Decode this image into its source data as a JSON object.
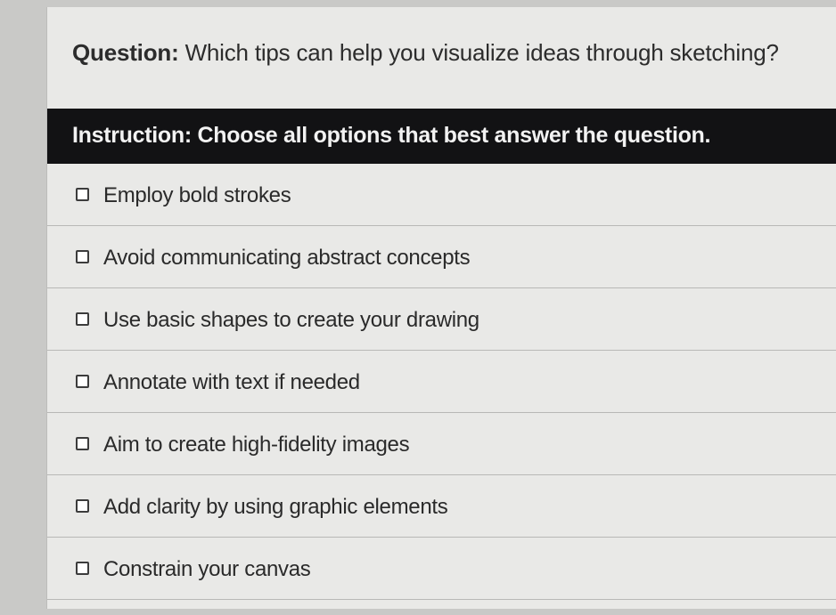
{
  "question": {
    "prefix": "Question:",
    "text": "Which tips can help you visualize ideas through sketching?"
  },
  "instruction": {
    "text": "Instruction: Choose all options that best answer the question."
  },
  "options": [
    {
      "label": "Employ bold strokes",
      "checked": false
    },
    {
      "label": "Avoid communicating abstract concepts",
      "checked": false
    },
    {
      "label": "Use basic shapes to create your drawing",
      "checked": false
    },
    {
      "label": "Annotate with text if needed",
      "checked": false
    },
    {
      "label": "Aim to create high-fidelity images",
      "checked": false
    },
    {
      "label": "Add clarity by using graphic elements",
      "checked": false
    },
    {
      "label": "Constrain your canvas",
      "checked": false
    }
  ]
}
